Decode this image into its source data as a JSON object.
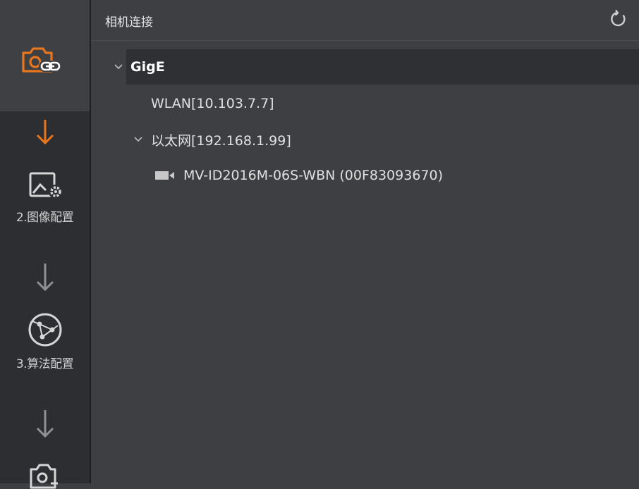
{
  "sidebar": {
    "steps": [
      {
        "label": "",
        "icon": "camera-link-icon",
        "active": true
      },
      {
        "label": "2.图像配置",
        "icon": "image-settings-icon"
      },
      {
        "label": "3.算法配置",
        "icon": "algorithm-network-icon"
      },
      {
        "label": "",
        "icon": "camera-export-icon"
      }
    ],
    "accent": "#e8761f"
  },
  "header": {
    "title": "相机连接",
    "refresh_icon": "refresh-icon"
  },
  "tree": {
    "root": {
      "label": "GigE",
      "expanded": true
    },
    "interfaces": [
      {
        "label": "WLAN[10.103.7.7]"
      },
      {
        "label": "以太网[192.168.1.99]",
        "expanded": true,
        "devices": [
          {
            "label": "MV-ID2016M-06S-WBN (00F83093670)",
            "icon": "camera-device-icon"
          }
        ]
      }
    ]
  }
}
